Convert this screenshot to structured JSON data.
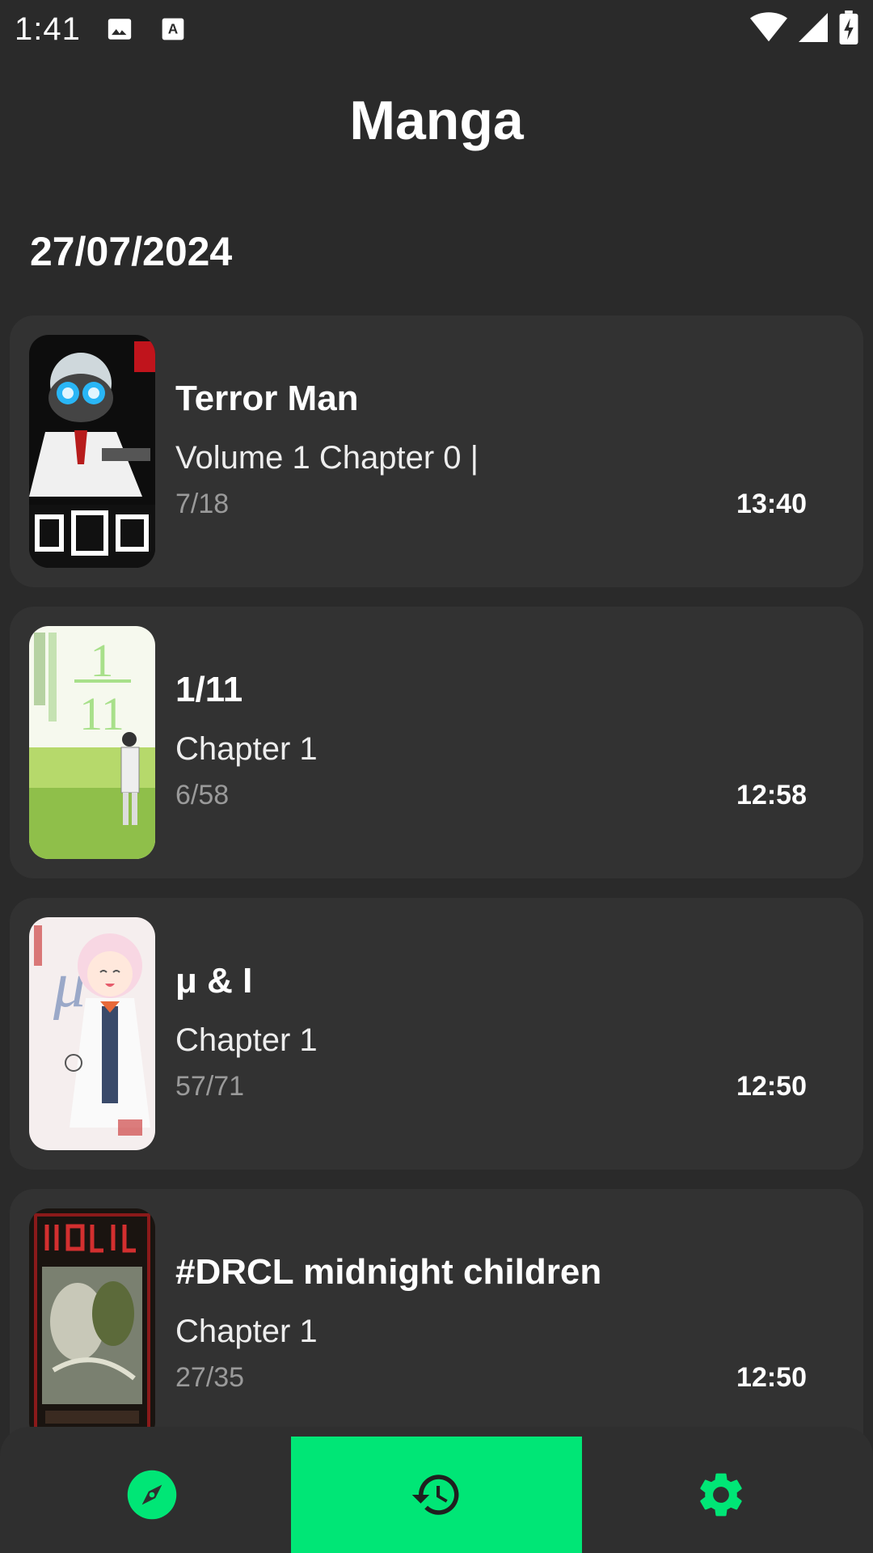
{
  "status": {
    "time": "1:41",
    "left_icons": [
      "image-icon",
      "text-icon"
    ],
    "right_icons": [
      "wifi-icon",
      "signal-icon",
      "battery-charging-icon"
    ]
  },
  "header": {
    "title": "Manga"
  },
  "section": {
    "date": "27/07/2024"
  },
  "items": [
    {
      "title": "Terror Man",
      "chapter": "Volume 1 Chapter 0 |",
      "progress": "7/18",
      "time": "13:40"
    },
    {
      "title": "1/11",
      "chapter": "Chapter 1",
      "progress": "6/58",
      "time": "12:58"
    },
    {
      "title": "μ & I",
      "chapter": "Chapter 1",
      "progress": "57/71",
      "time": "12:50"
    },
    {
      "title": "#DRCL midnight children",
      "chapter": "Chapter 1",
      "progress": "27/35",
      "time": "12:50"
    }
  ],
  "nav": {
    "items": [
      {
        "icon": "compass-icon",
        "active": false
      },
      {
        "icon": "history-icon",
        "active": true
      },
      {
        "icon": "settings-icon",
        "active": false
      }
    ],
    "active_color": "#00e676",
    "icon_color": "#00e676"
  },
  "colors": {
    "background": "#2a2a2a",
    "card": "#323232",
    "accent": "#00e676"
  }
}
